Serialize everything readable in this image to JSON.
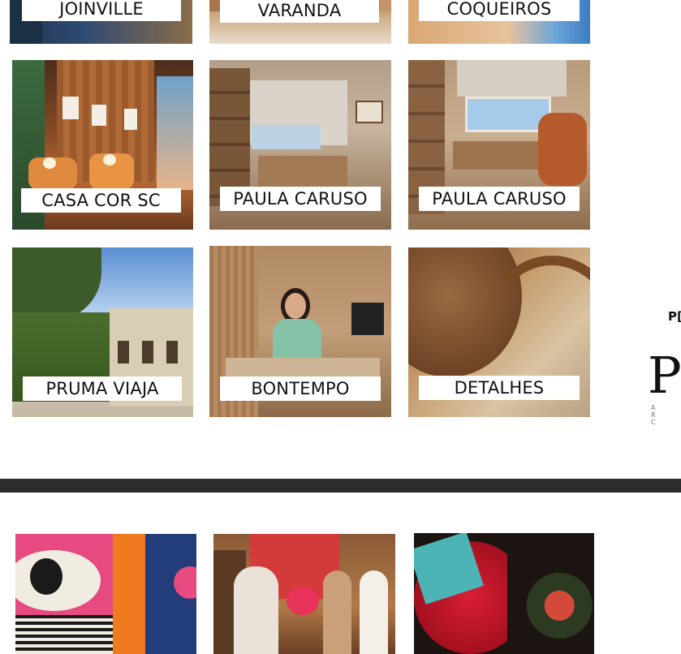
{
  "grid": {
    "row1": [
      "JOINVILLE",
      "VARANDA",
      "COQUEIROS"
    ],
    "row2": [
      "CASA COR SC",
      "PAULA CARUSO",
      "PAULA CARUSO"
    ],
    "row3": [
      "PRUMA VIAJA",
      "BONTEMPO",
      "DETALHES"
    ]
  },
  "brand": {
    "small": "P[",
    "big": "PI",
    "sub": "A R C"
  },
  "colors": {
    "divider": "#2c2c2c",
    "label_bg": "#ffffff"
  }
}
